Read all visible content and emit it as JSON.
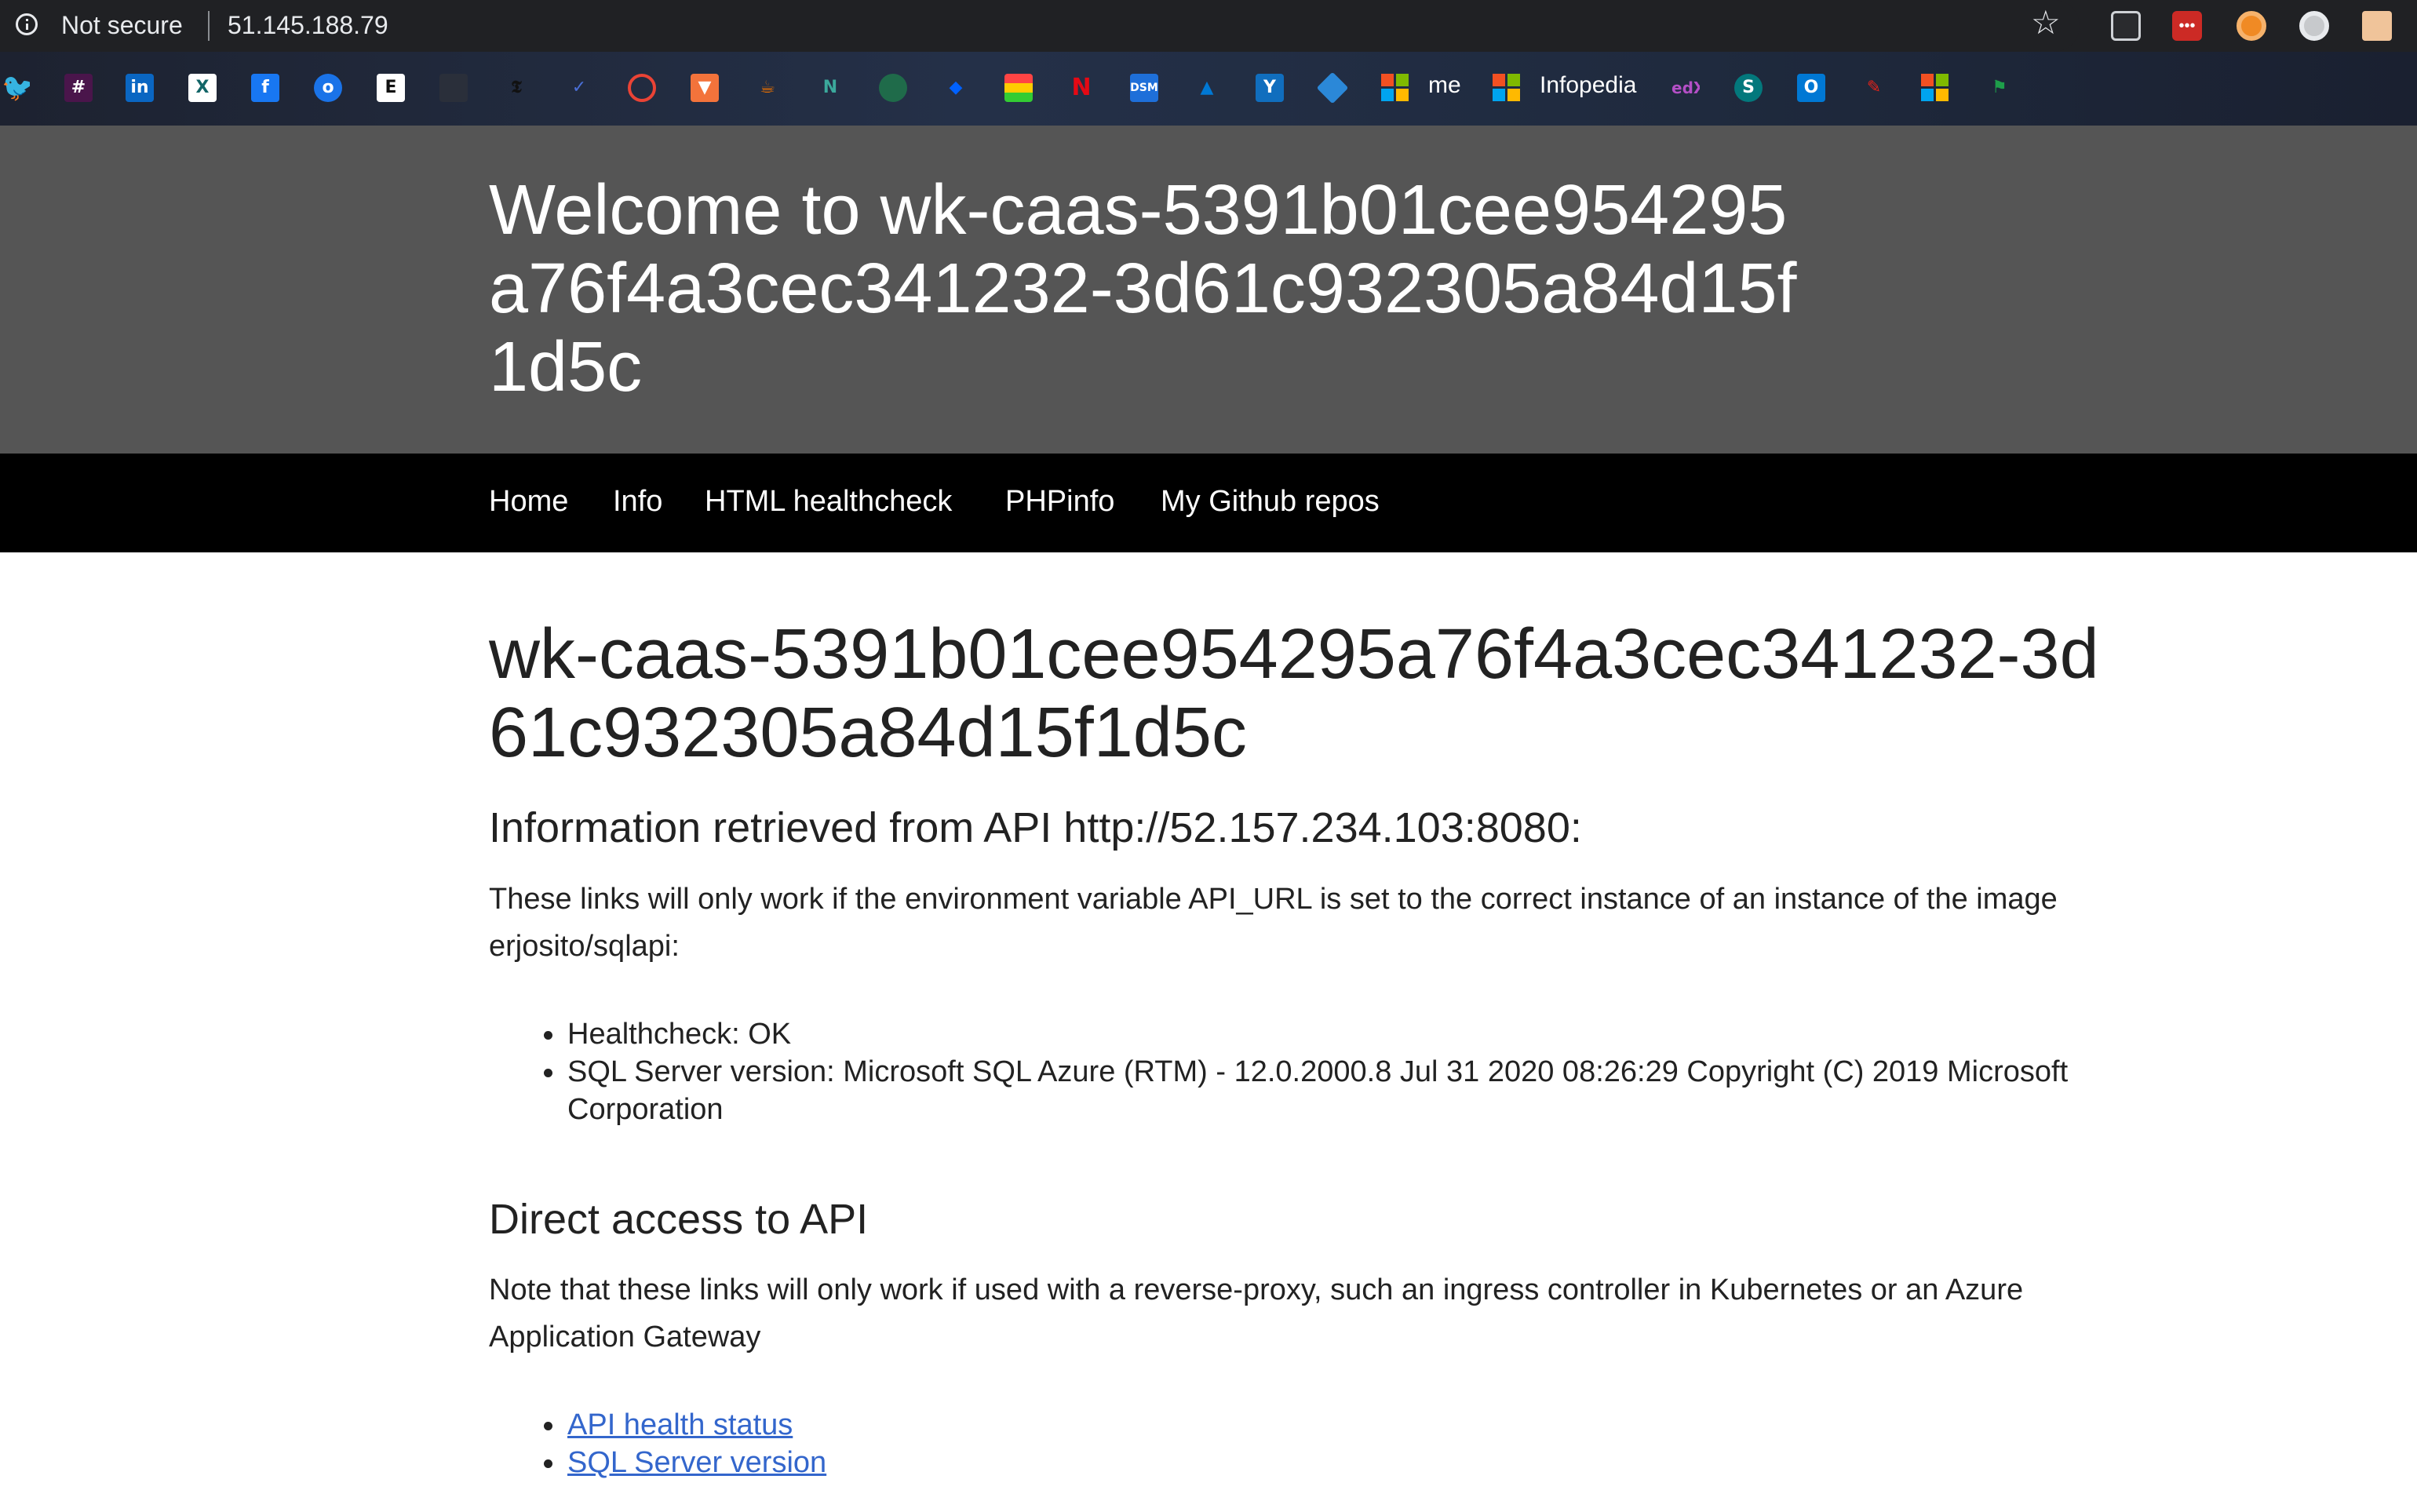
{
  "browser": {
    "security_label": "Not secure",
    "url": "51.145.188.79",
    "bookmarks": {
      "me_label": "me",
      "infopedia_label": "Infopedia"
    }
  },
  "header": {
    "title": "Welcome to wk-caas-5391b01cee954295a76f4a3cec341232-3d61c932305a84d15f1d5c"
  },
  "nav": {
    "items": [
      "Home",
      "Info",
      "HTML healthcheck",
      "PHPinfo",
      "My Github repos"
    ]
  },
  "main": {
    "heading": "wk-caas-5391b01cee954295a76f4a3cec341232-3d61c932305a84d15f1d5c",
    "api_info": {
      "heading": "Information retrieved from API http://52.157.234.103:8080:",
      "description": "These links will only work if the environment variable API_URL is set to the correct instance of an instance of the image erjosito/sqlapi:",
      "items": [
        "Healthcheck: OK",
        "SQL Server version: Microsoft SQL Azure (RTM) - 12.0.2000.8 Jul 31 2020 08:26:29 Copyright (C) 2019 Microsoft Corporation"
      ]
    },
    "direct_access": {
      "heading": "Direct access to API",
      "description": "Note that these links will only work if used with a reverse-proxy, such an ingress controller in Kubernetes or an Azure Application Gateway",
      "links": [
        "API health status",
        "SQL Server version"
      ]
    }
  }
}
